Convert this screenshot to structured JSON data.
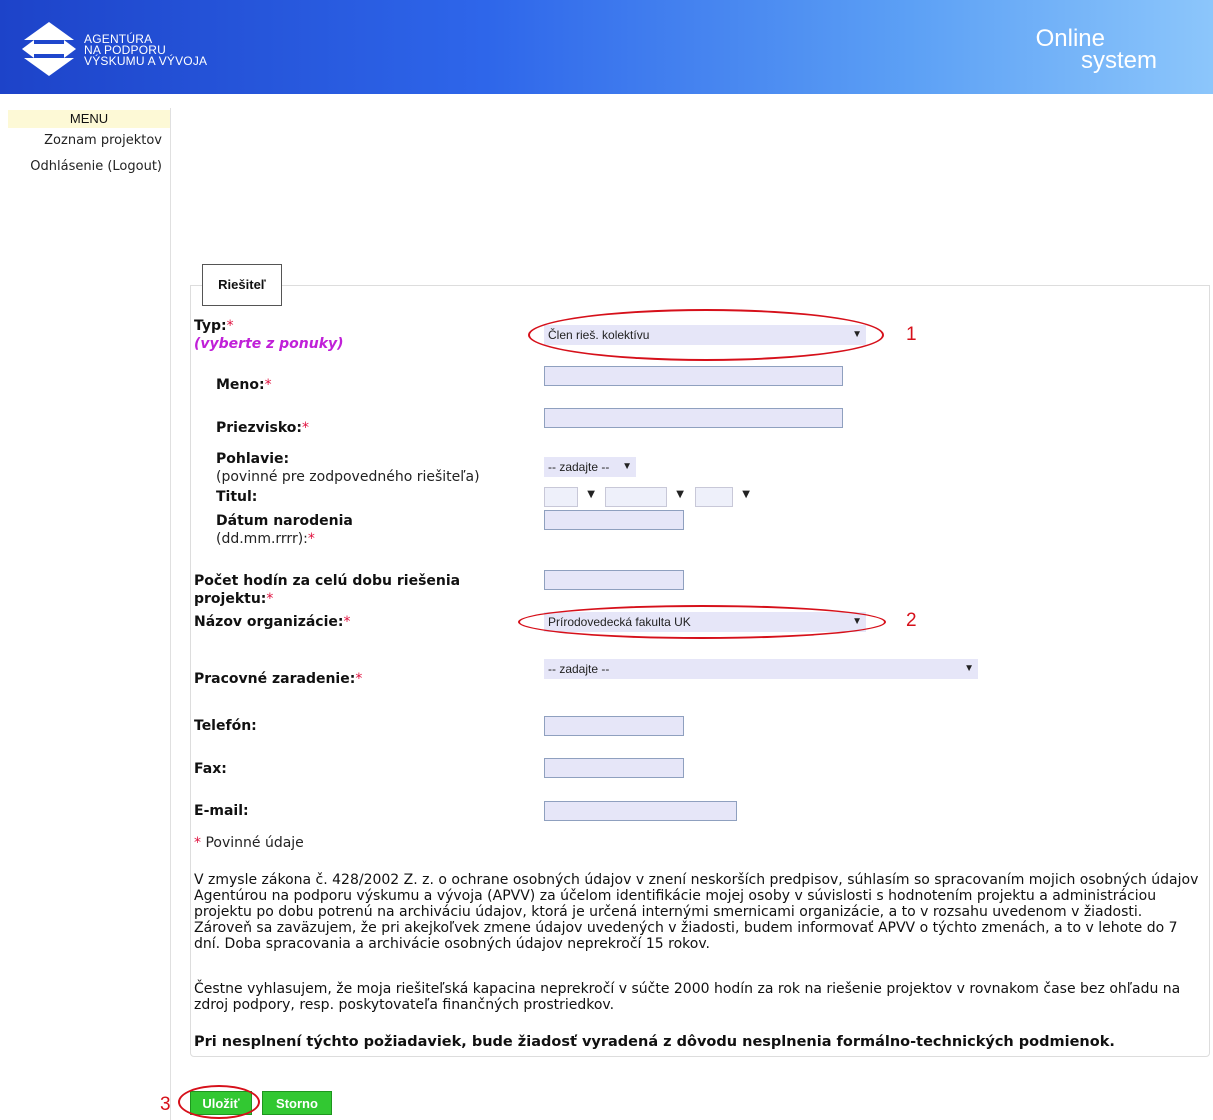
{
  "header": {
    "logo_lines": [
      "AGENTÚRA",
      "NA PODPORU",
      "VÝSKUMU A VÝVOJA"
    ],
    "brand_line1": "Online",
    "brand_line2": "system"
  },
  "sidebar": {
    "menu_title": "MENU",
    "items": [
      {
        "label": "Zoznam projektov"
      },
      {
        "label": "Odhlásenie (Logout)"
      }
    ]
  },
  "tab": {
    "label": "Riešiteľ"
  },
  "form": {
    "typ": {
      "label": "Typ:",
      "req": "*",
      "hint": "(vyberte z ponuky)",
      "value": "Člen rieš. kolektívu"
    },
    "meno": {
      "label": "Meno:",
      "req": "*",
      "value": ""
    },
    "priezvisko": {
      "label": "Priezvisko:",
      "req": "*",
      "value": ""
    },
    "pohlavie": {
      "label": "Pohlavie:",
      "note": "(povinné pre zodpovedného riešiteľa)",
      "value": "-- zadajte --"
    },
    "titul": {
      "label": "Titul:"
    },
    "datum": {
      "label": "Dátum narodenia",
      "note": "(dd.mm.rrrr):",
      "req": "*",
      "value": ""
    },
    "pocet_hodin": {
      "label_line1": "Počet hodín za celú dobu riešenia",
      "label_line2": "projektu:",
      "req": "*",
      "value": ""
    },
    "organizacia": {
      "label": "Názov organizácie:",
      "req": "*",
      "value": "Prírodovedecká fakulta UK"
    },
    "zaradenie": {
      "label": "Pracovné zaradenie:",
      "req": "*",
      "value": "-- zadajte --"
    },
    "telefon": {
      "label": "Telefón:",
      "value": ""
    },
    "fax": {
      "label": "Fax:",
      "value": ""
    },
    "email": {
      "label": "E-mail:",
      "value": ""
    },
    "required_note_star": "*",
    "required_note": "Povinné údaje"
  },
  "texts": {
    "consent": "V zmysle zákona č. 428/2002 Z. z. o ochrane osobných údajov v znení neskorších predpisov, súhlasím so spracovaním mojich osobných údajov Agentúrou na podporu výskumu a vývoja (APVV) za účelom identifikácie mojej osoby v súvislosti s hodnotením projektu a administráciou projektu po dobu potrenú na archiváciu údajov, ktorá je určená internými smernicami organizácie, a to v rozsahu uvedenom v žiadosti. Zároveň sa zaväzujem, že pri akejkoľvek zmene údajov uvedených v žiadosti, budem informovať APVV o týchto zmenách, a to v lehote do 7 dní. Doba spracovania a archivácie osobných údajov neprekročí 15 rokov.",
    "declaration": "Čestne vyhlasujem, že moja riešiteľská kapacina neprekročí v súčte 2000 hodín za rok na riešenie projektov v rovnakom čase bez ohľadu na zdroj podpory, resp. poskytovateľa finančných prostriedkov.",
    "warning": "Pri nesplnení týchto požiadaviek, bude žiadosť vyradená z dôvodu nesplnenia formálno-technických podmienok."
  },
  "annotations": {
    "n1": "1",
    "n2": "2",
    "n3": "3"
  },
  "buttons": {
    "save": "Uložiť",
    "cancel": "Storno"
  }
}
